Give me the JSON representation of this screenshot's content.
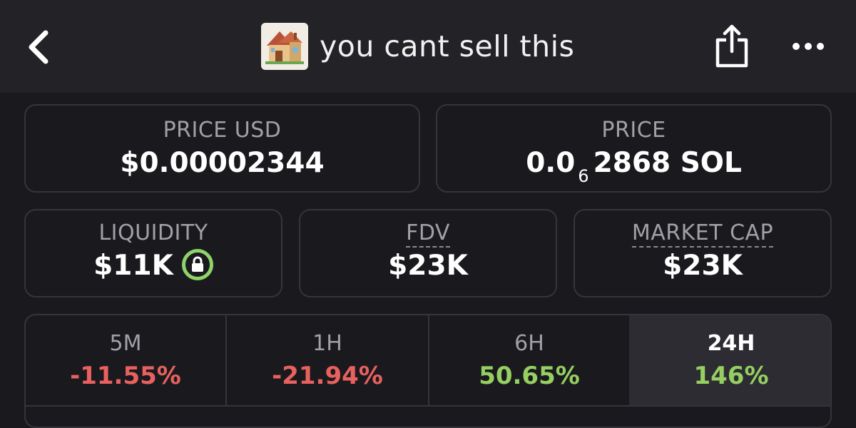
{
  "header": {
    "back_icon": "chevron-left-icon",
    "token_logo": "house-emoji",
    "token_name": "you cant sell this",
    "share_icon": "share-icon",
    "more_icon": "more-horizontal-icon"
  },
  "price_usd": {
    "label": "PRICE USD",
    "value": "$0.00002344"
  },
  "price_sol": {
    "label": "PRICE",
    "prefix": "0.0",
    "zeros": "6",
    "suffix": "2868 SOL"
  },
  "liquidity": {
    "label": "LIQUIDITY",
    "value": "$11K",
    "lock_icon": "lock-icon",
    "lock_color": "#8ed36a"
  },
  "fdv": {
    "label": "FDV",
    "value": "$23K"
  },
  "market_cap": {
    "label": "MARKET CAP",
    "value": "$23K"
  },
  "timeframes": [
    {
      "label": "5M",
      "change": "-11.55%",
      "trend": "down"
    },
    {
      "label": "1H",
      "change": "-21.94%",
      "trend": "down"
    },
    {
      "label": "6H",
      "change": "50.65%",
      "trend": "up"
    },
    {
      "label": "24H",
      "change": "146%",
      "trend": "up",
      "selected": true
    }
  ],
  "colors": {
    "negative": "#e8615f",
    "positive": "#95cf62",
    "background": "#1a1a1e",
    "header_bg": "#232327",
    "card_border": "#34343a"
  }
}
